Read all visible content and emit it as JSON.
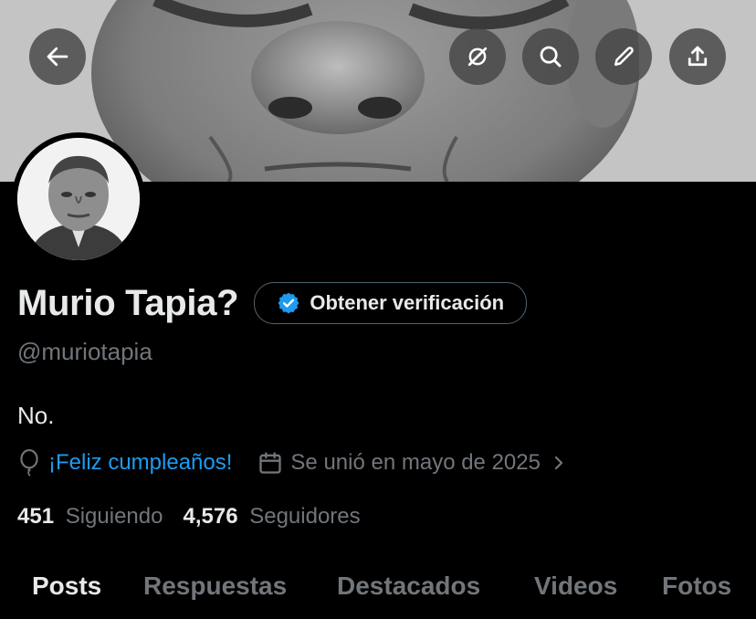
{
  "banner": {
    "description_icon": "banner-photo"
  },
  "header_buttons": {
    "back": {
      "icon": "arrow-left-icon"
    },
    "grok": {
      "icon": "grok-icon"
    },
    "search": {
      "icon": "search-icon"
    },
    "edit": {
      "icon": "pencil-icon"
    },
    "share": {
      "icon": "share-icon"
    }
  },
  "profile": {
    "name": "Murio Tapia?",
    "verify_label": "Obtener verificación",
    "handle": "@muriotapia",
    "bio": "No.",
    "birthday": "¡Feliz cumpleaños!",
    "joined": "Se unió en mayo de 2025",
    "following_count": "451",
    "following_label": "Siguiendo",
    "followers_count": "4,576",
    "followers_label": "Seguidores"
  },
  "tabs": [
    {
      "label": "Posts",
      "active": true
    },
    {
      "label": "Respuestas",
      "active": false
    },
    {
      "label": "Destacados",
      "active": false
    },
    {
      "label": "Videos",
      "active": false
    },
    {
      "label": "Fotos",
      "active": false
    }
  ],
  "colors": {
    "background": "#000000",
    "text_primary": "#e7e9ea",
    "text_secondary": "#71767b",
    "accent_blue": "#1d9bf0"
  }
}
